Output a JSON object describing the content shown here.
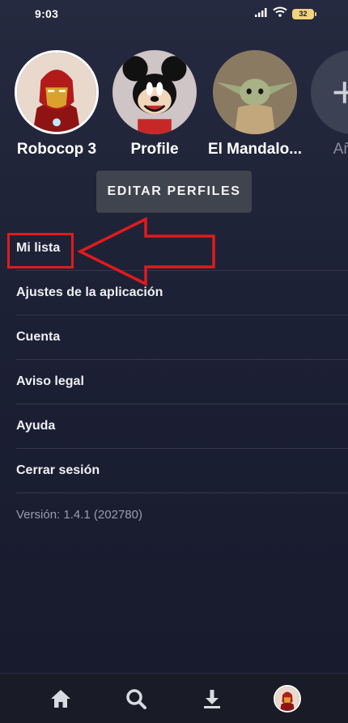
{
  "status_bar": {
    "time": "9:03",
    "battery": "32",
    "icons": [
      "signal-icon",
      "wifi-icon",
      "battery-icon"
    ]
  },
  "profiles": [
    {
      "name": "Robocop 3",
      "avatar": "iron-man-avatar",
      "selected": true
    },
    {
      "name": "Profile",
      "avatar": "mickey-avatar",
      "selected": false
    },
    {
      "name": "El Mandalo...",
      "avatar": "grogu-avatar",
      "selected": false
    },
    {
      "name": "Añadi",
      "avatar": "add-profile-avatar",
      "selected": false
    }
  ],
  "edit_profiles_label": "EDITAR PERFILES",
  "menu": [
    {
      "label": "Mi lista"
    },
    {
      "label": "Ajustes de la aplicación"
    },
    {
      "label": "Cuenta"
    },
    {
      "label": "Aviso legal"
    },
    {
      "label": "Ayuda"
    },
    {
      "label": "Cerrar sesión"
    }
  ],
  "version": "Versión: 1.4.1 (202780)",
  "bottom_nav": [
    "home-icon",
    "search-icon",
    "download-icon",
    "profile-avatar"
  ],
  "colors": {
    "background": "#1c2034",
    "annotation": "#e01b1b",
    "button": "#40444f",
    "battery": "#f1d37a"
  }
}
